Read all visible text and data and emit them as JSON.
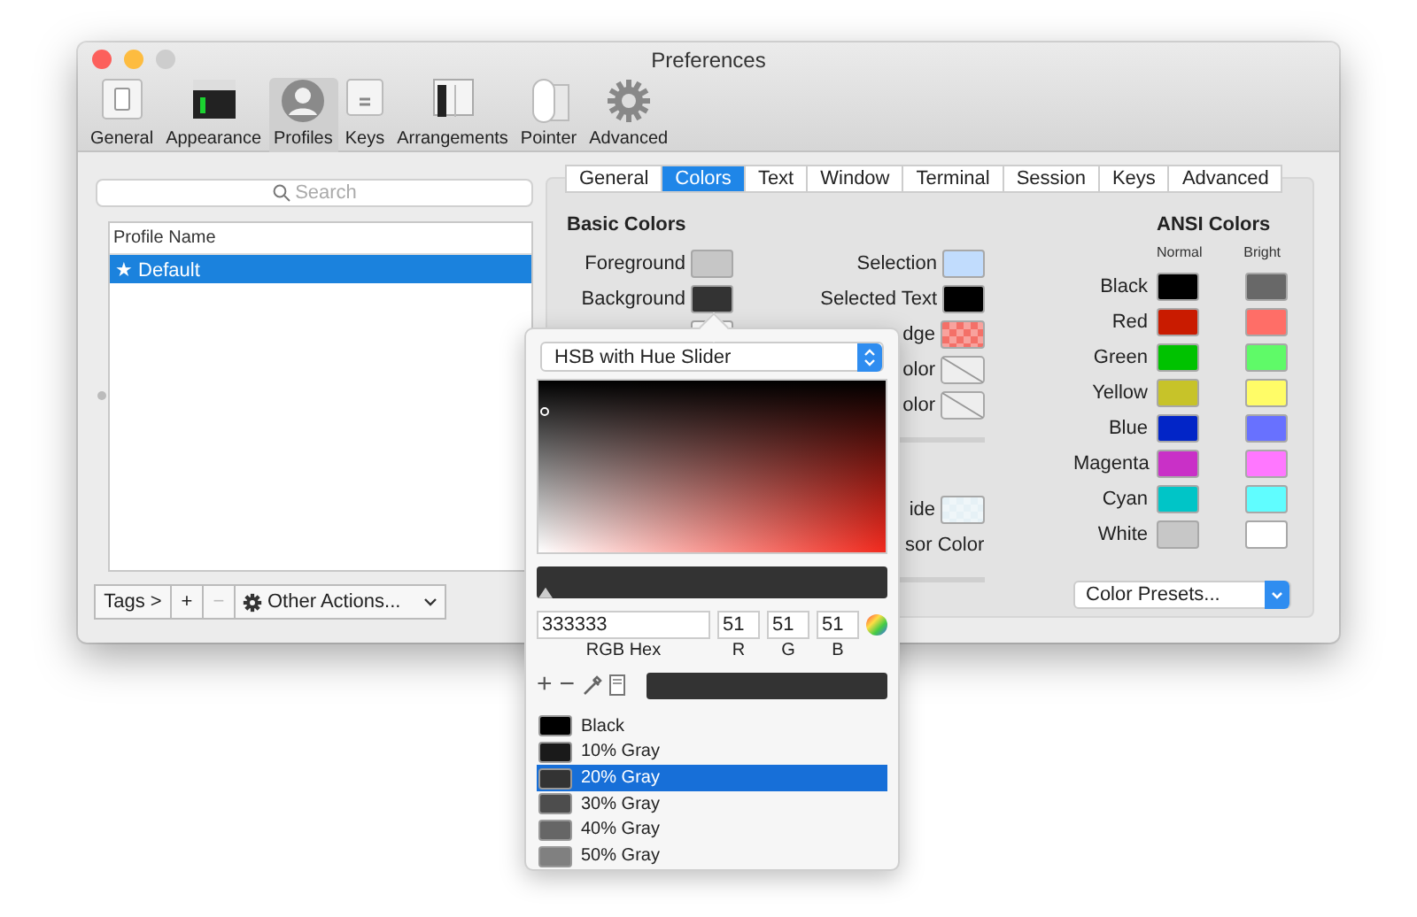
{
  "window": {
    "title": "Preferences"
  },
  "toolbar": [
    {
      "label": "General",
      "selected": false
    },
    {
      "label": "Appearance",
      "selected": false
    },
    {
      "label": "Profiles",
      "selected": true
    },
    {
      "label": "Keys",
      "selected": false
    },
    {
      "label": "Arrangements",
      "selected": false
    },
    {
      "label": "Pointer",
      "selected": false
    },
    {
      "label": "Advanced",
      "selected": false
    }
  ],
  "profiles": {
    "search_placeholder": "Search",
    "column": "Profile Name",
    "items": [
      {
        "label": "★ Default",
        "selected": true
      }
    ],
    "tags_button": "Tags >",
    "add": "+",
    "remove": "−",
    "actions": "Other Actions..."
  },
  "tabs": [
    {
      "label": "General",
      "selected": false
    },
    {
      "label": "Colors",
      "selected": true
    },
    {
      "label": "Text",
      "selected": false
    },
    {
      "label": "Window",
      "selected": false
    },
    {
      "label": "Terminal",
      "selected": false
    },
    {
      "label": "Session",
      "selected": false
    },
    {
      "label": "Keys",
      "selected": false
    },
    {
      "label": "Advanced",
      "selected": false
    }
  ],
  "basic_colors": {
    "title": "Basic Colors",
    "left": [
      {
        "label": "Foreground",
        "color": "#c6c6c6"
      },
      {
        "label": "Background",
        "color": "#333333"
      },
      {
        "color": "#ffffff"
      }
    ],
    "right": [
      {
        "kind": "swatch",
        "label": "Selection",
        "color": "#c1dcfd"
      },
      {
        "kind": "swatch",
        "label": "Selected Text",
        "color": "#000000"
      },
      {
        "kind": "checker",
        "label": "dge",
        "color": "#f47068"
      },
      {
        "kind": "empty",
        "label": "olor"
      },
      {
        "kind": "empty",
        "label": "olor"
      },
      {
        "kind": "divider"
      },
      {
        "kind": "blank"
      },
      {
        "kind": "checker",
        "label": "ide",
        "color": "#e6f1f6"
      },
      {
        "kind": "text",
        "label": "sor Color"
      },
      {
        "kind": "divider"
      }
    ]
  },
  "ansi_colors": {
    "title": "ANSI Colors",
    "normal_heading": "Normal",
    "bright_heading": "Bright",
    "rows": [
      {
        "label": "Black",
        "normal": {
          "color": "#000000"
        },
        "bright": {
          "color": "#686868"
        }
      },
      {
        "label": "Red",
        "normal": {
          "color": "#c91b00"
        },
        "bright": {
          "color": "#ff6e67"
        }
      },
      {
        "label": "Green",
        "normal": {
          "color": "#00c200"
        },
        "bright": {
          "color": "#5ffa68"
        }
      },
      {
        "label": "Yellow",
        "normal": {
          "color": "#c7c329"
        },
        "bright": {
          "color": "#fffc67"
        }
      },
      {
        "label": "Blue",
        "normal": {
          "color": "#0225c7"
        },
        "bright": {
          "color": "#6871ff"
        }
      },
      {
        "label": "Magenta",
        "normal": {
          "color": "#c930c7"
        },
        "bright": {
          "color": "#ff77ff"
        }
      },
      {
        "label": "Cyan",
        "normal": {
          "color": "#00c5c7"
        },
        "bright": {
          "color": "#60fdff"
        }
      },
      {
        "label": "White",
        "normal": {
          "color": "#c7c7c7"
        },
        "bright": {
          "color": "#ffffff"
        }
      }
    ],
    "presets": "Color Presets..."
  },
  "picker": {
    "mode": "HSB with Hue Slider",
    "hue_slider": {
      "level": 0
    },
    "hex": "333333",
    "hex_label": "RGB Hex",
    "channels": [
      {
        "label": "R",
        "value": "51"
      },
      {
        "label": "G",
        "value": "51"
      },
      {
        "label": "B",
        "value": "51"
      }
    ],
    "current": {
      "color": "#333333"
    },
    "add": "+",
    "remove": "−",
    "swatches": [
      {
        "name": "Black",
        "color": "#000000",
        "selected": false
      },
      {
        "name": "10% Gray",
        "color": "#1a1a1a",
        "selected": false
      },
      {
        "name": "20% Gray",
        "color": "#333333",
        "selected": true
      },
      {
        "name": "30% Gray",
        "color": "#4d4d4d",
        "selected": false
      },
      {
        "name": "40% Gray",
        "color": "#666666",
        "selected": false
      },
      {
        "name": "50% Gray",
        "color": "#808080",
        "selected": false
      }
    ]
  }
}
